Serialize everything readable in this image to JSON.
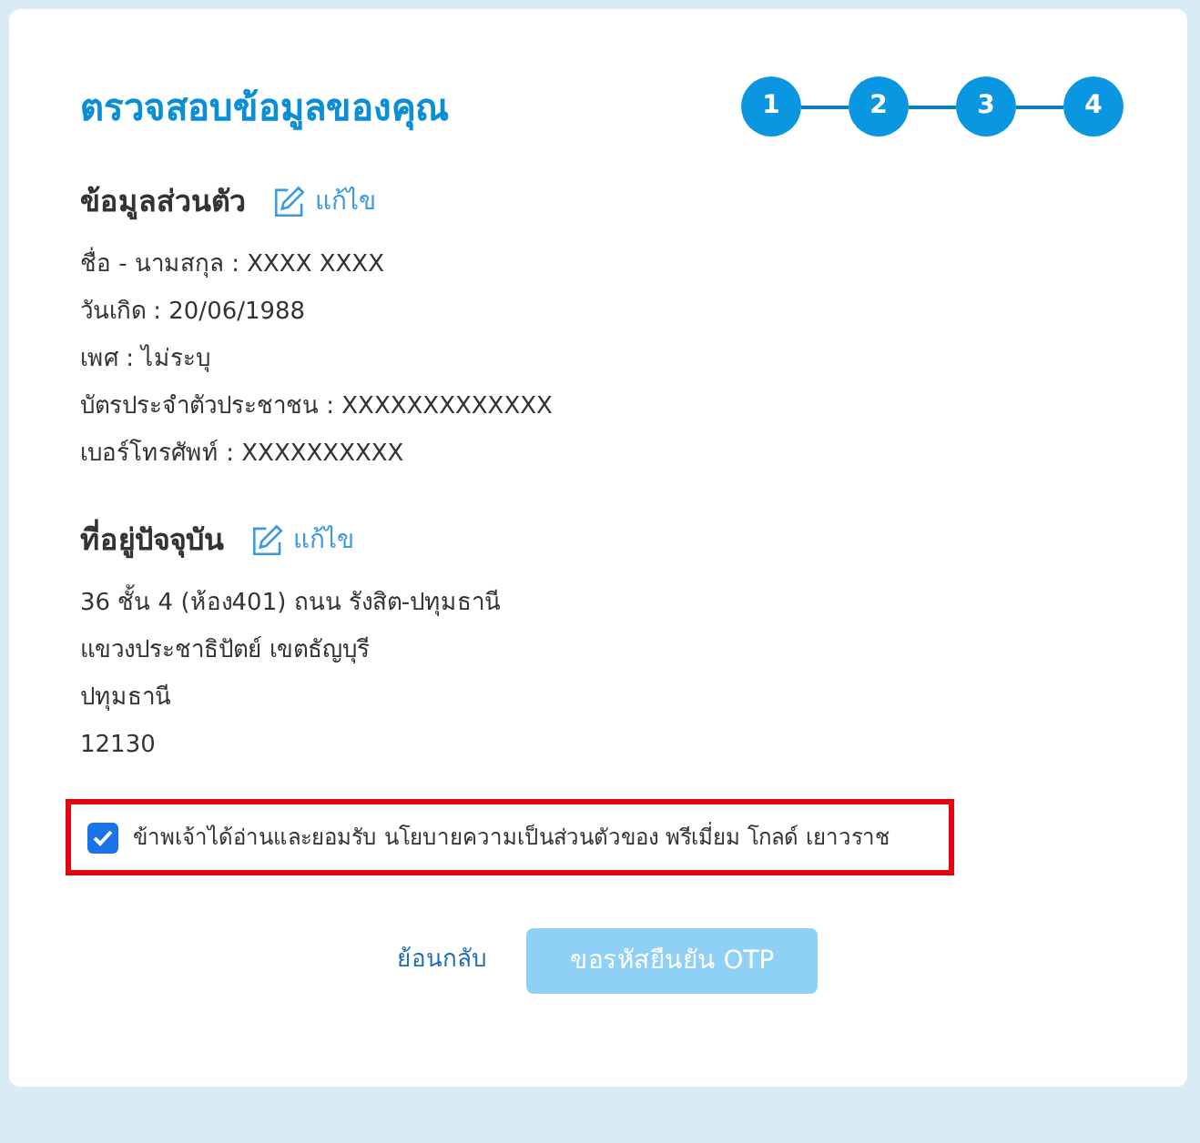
{
  "title": "ตรวจสอบข้อมูลของคุณ",
  "steps": [
    "1",
    "2",
    "3",
    "4"
  ],
  "sections": [
    {
      "heading": "ข้อมูลส่วนตัว",
      "edit_label": "แก้ไข",
      "lines": [
        "ชื่อ - นามสกุล : XXXX XXXX",
        "วันเกิด : 20/06/1988",
        "เพศ : ไม่ระบุ",
        "บัตรประจำตัวประชาชน : XXXXXXXXXXXXX",
        "เบอร์โทรศัพท์ : XXXXXXXXXX"
      ]
    },
    {
      "heading": "ที่อยู่ปัจจุบัน",
      "edit_label": "แก้ไข",
      "lines": [
        "36 ชั้น 4 (ห้อง401) ถนน รังสิต-ปทุมธานี",
        "แขวงประชาธิปัตย์ เขตธัญบุรี",
        "ปทุมธานี",
        "12130"
      ]
    }
  ],
  "consent": {
    "label": "ข้าพเจ้าได้อ่านและยอมรับ นโยบายความเป็นส่วนตัวของ พรีเมี่ยม โกลด์ เยาวราช",
    "checked": true
  },
  "back_link": "ย้อนกลับ",
  "submit": {
    "label": "ขอรหัสยืนยัน OTP",
    "disabled": true
  }
}
